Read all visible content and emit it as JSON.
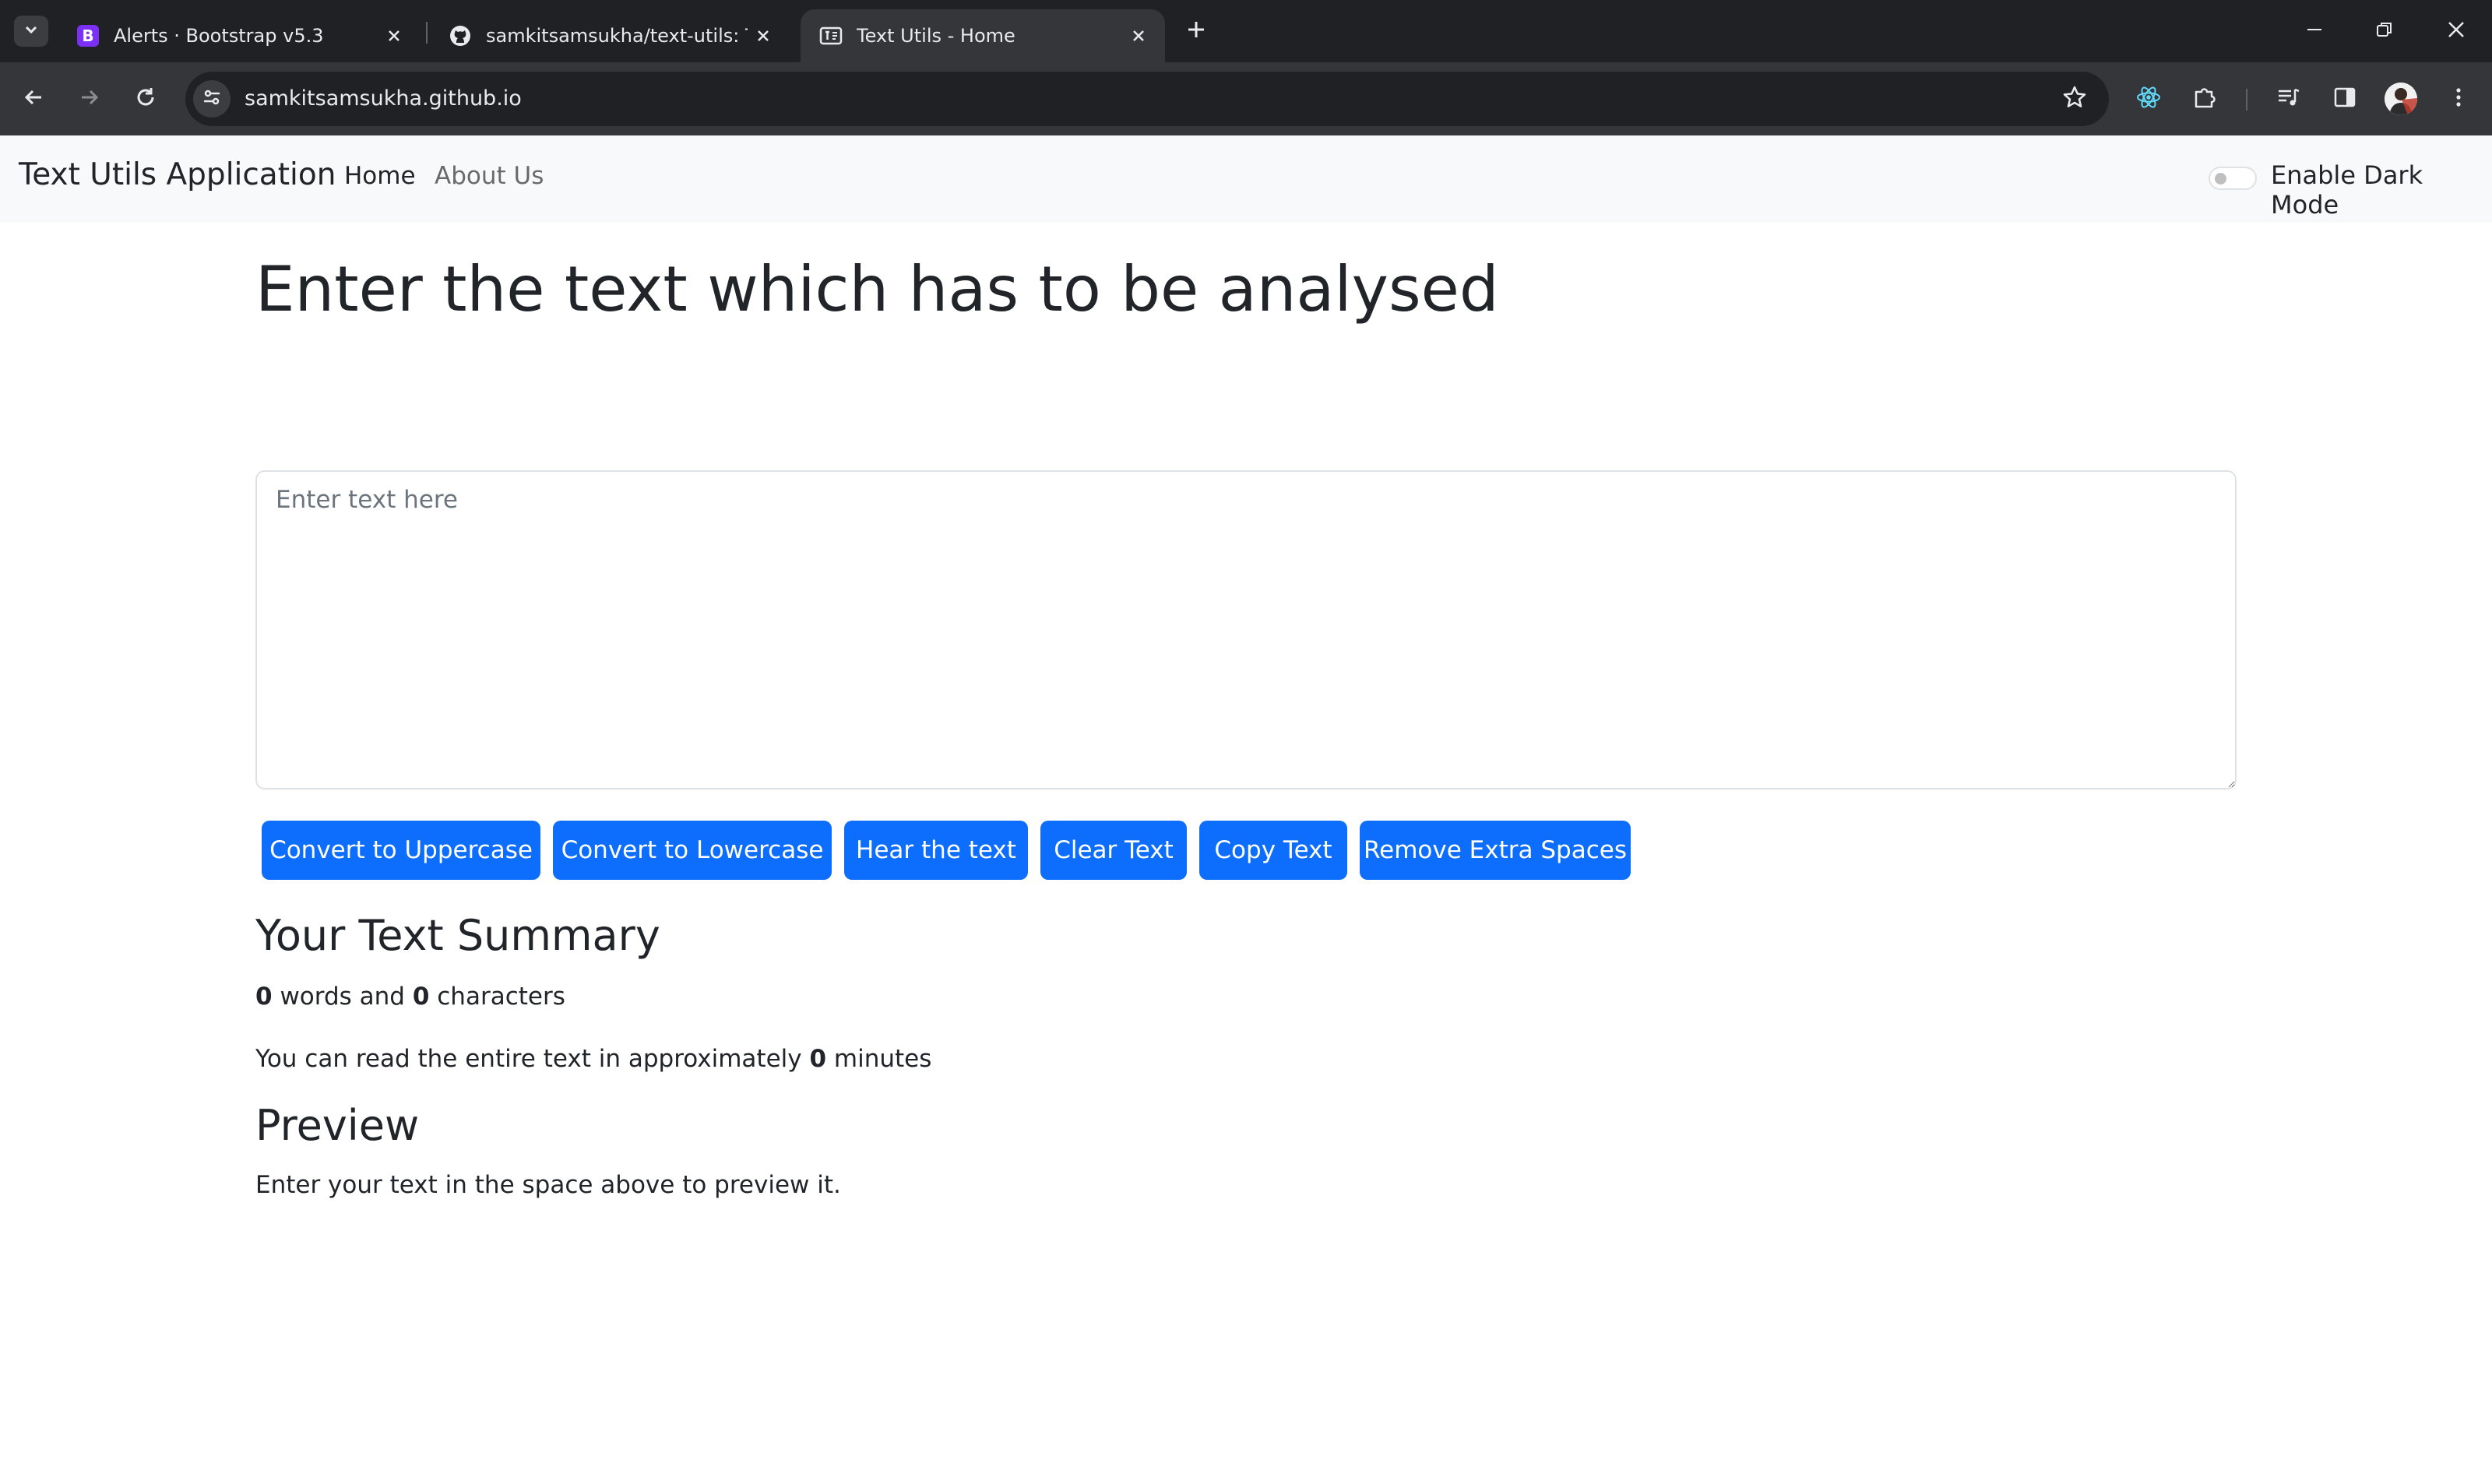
{
  "browser": {
    "tabs": [
      {
        "title": "Alerts · Bootstrap v5.3",
        "favicon": "bootstrap-icon",
        "active": false
      },
      {
        "title": "samkitsamsukha/text-utils: Tutorial",
        "favicon": "github-icon",
        "active": false
      },
      {
        "title": "Text Utils - Home",
        "favicon": "textutils-page-icon",
        "active": true
      }
    ],
    "url": "samkitsamsukha.github.io",
    "colors": {
      "tabbar": "#202124",
      "toolbar": "#35363a",
      "omnibox": "#202124"
    }
  },
  "navbar": {
    "brand": "Text Utils Application",
    "links": [
      {
        "label": "Home",
        "active": true
      },
      {
        "label": "About Us",
        "active": false
      }
    ],
    "dark_mode_label": "Enable Dark Mode",
    "dark_mode_enabled": false
  },
  "main": {
    "heading": "Enter the text which has to be analysed",
    "textarea": {
      "value": "",
      "placeholder": "Enter text here"
    },
    "buttons": [
      "Convert to Uppercase",
      "Convert to Lowercase",
      "Hear the text",
      "Clear Text",
      "Copy Text",
      "Remove Extra Spaces"
    ],
    "summary": {
      "title": "Your Text Summary",
      "word_count": "0",
      "words_label": "words and",
      "char_count": "0",
      "chars_label": "characters",
      "read_prefix": "You can read the entire text in approximately",
      "read_minutes": "0",
      "read_suffix": "minutes"
    },
    "preview": {
      "title": "Preview",
      "text": "Enter your text in the space above to preview it."
    }
  },
  "colors": {
    "primary": "#0d6efd",
    "navbar_bg": "#f8f9fa",
    "text": "#212529"
  }
}
